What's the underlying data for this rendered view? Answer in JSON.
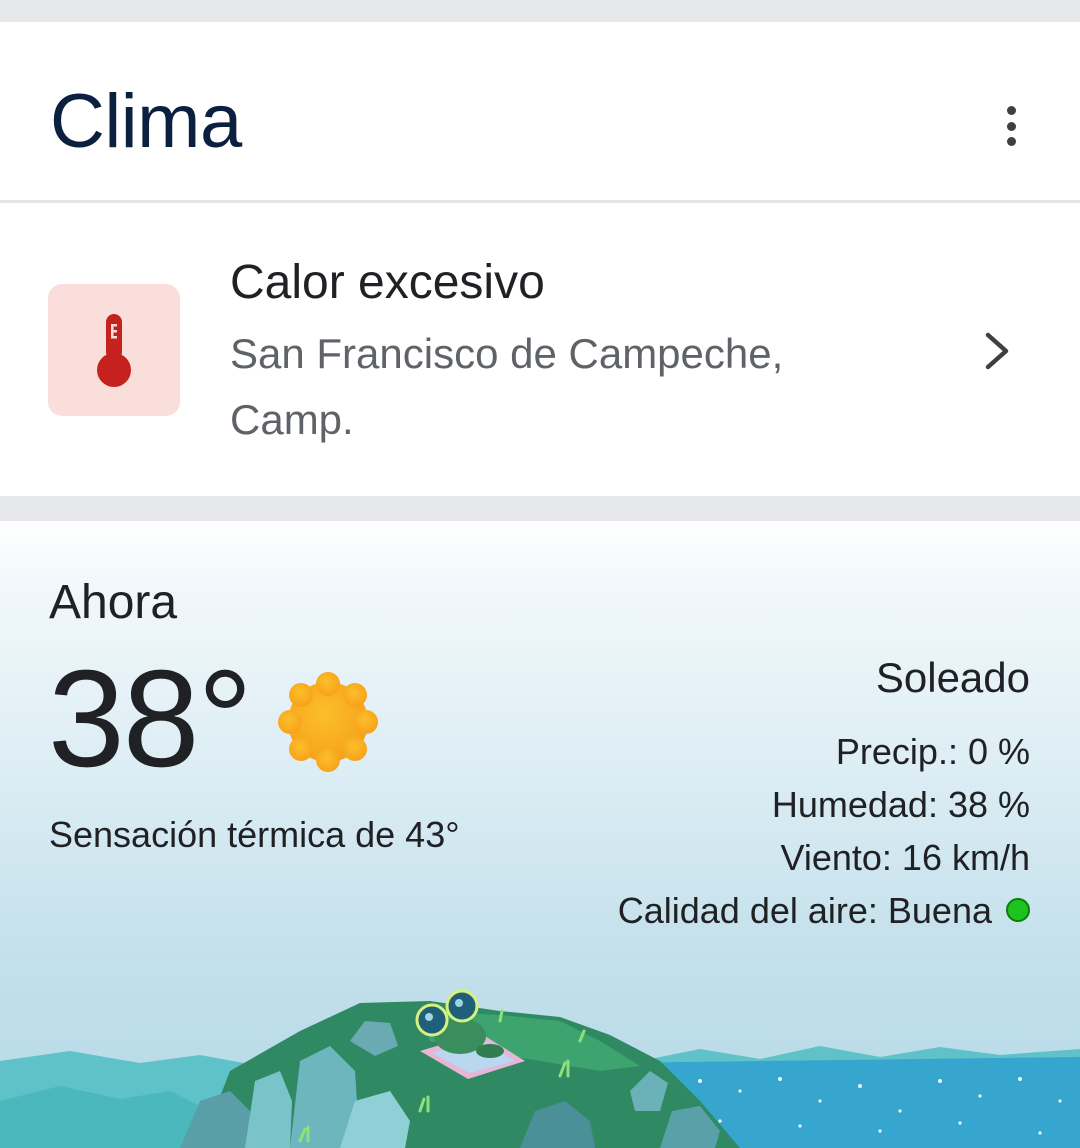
{
  "header": {
    "title": "Clima",
    "menu_icon": "more-vert-icon"
  },
  "alert": {
    "icon": "thermometer-icon",
    "title": "Calor excesivo",
    "location": "San Francisco de Campeche, Camp.",
    "chevron_icon": "chevron-right-icon",
    "colors": {
      "icon_bg": "#f9dedc",
      "icon_fg": "#c5221f"
    }
  },
  "now": {
    "label": "Ahora",
    "temperature": "38°",
    "condition_icon": "sun-icon",
    "feels_like": "Sensación térmica de 43°",
    "condition": "Soleado",
    "precipitation": "Precip.: 0 %",
    "humidity": "Humedad: 38 %",
    "wind": "Viento: 16 km/h",
    "air_quality": "Calidad del aire: Buena",
    "air_quality_color": "#1ec41e"
  }
}
